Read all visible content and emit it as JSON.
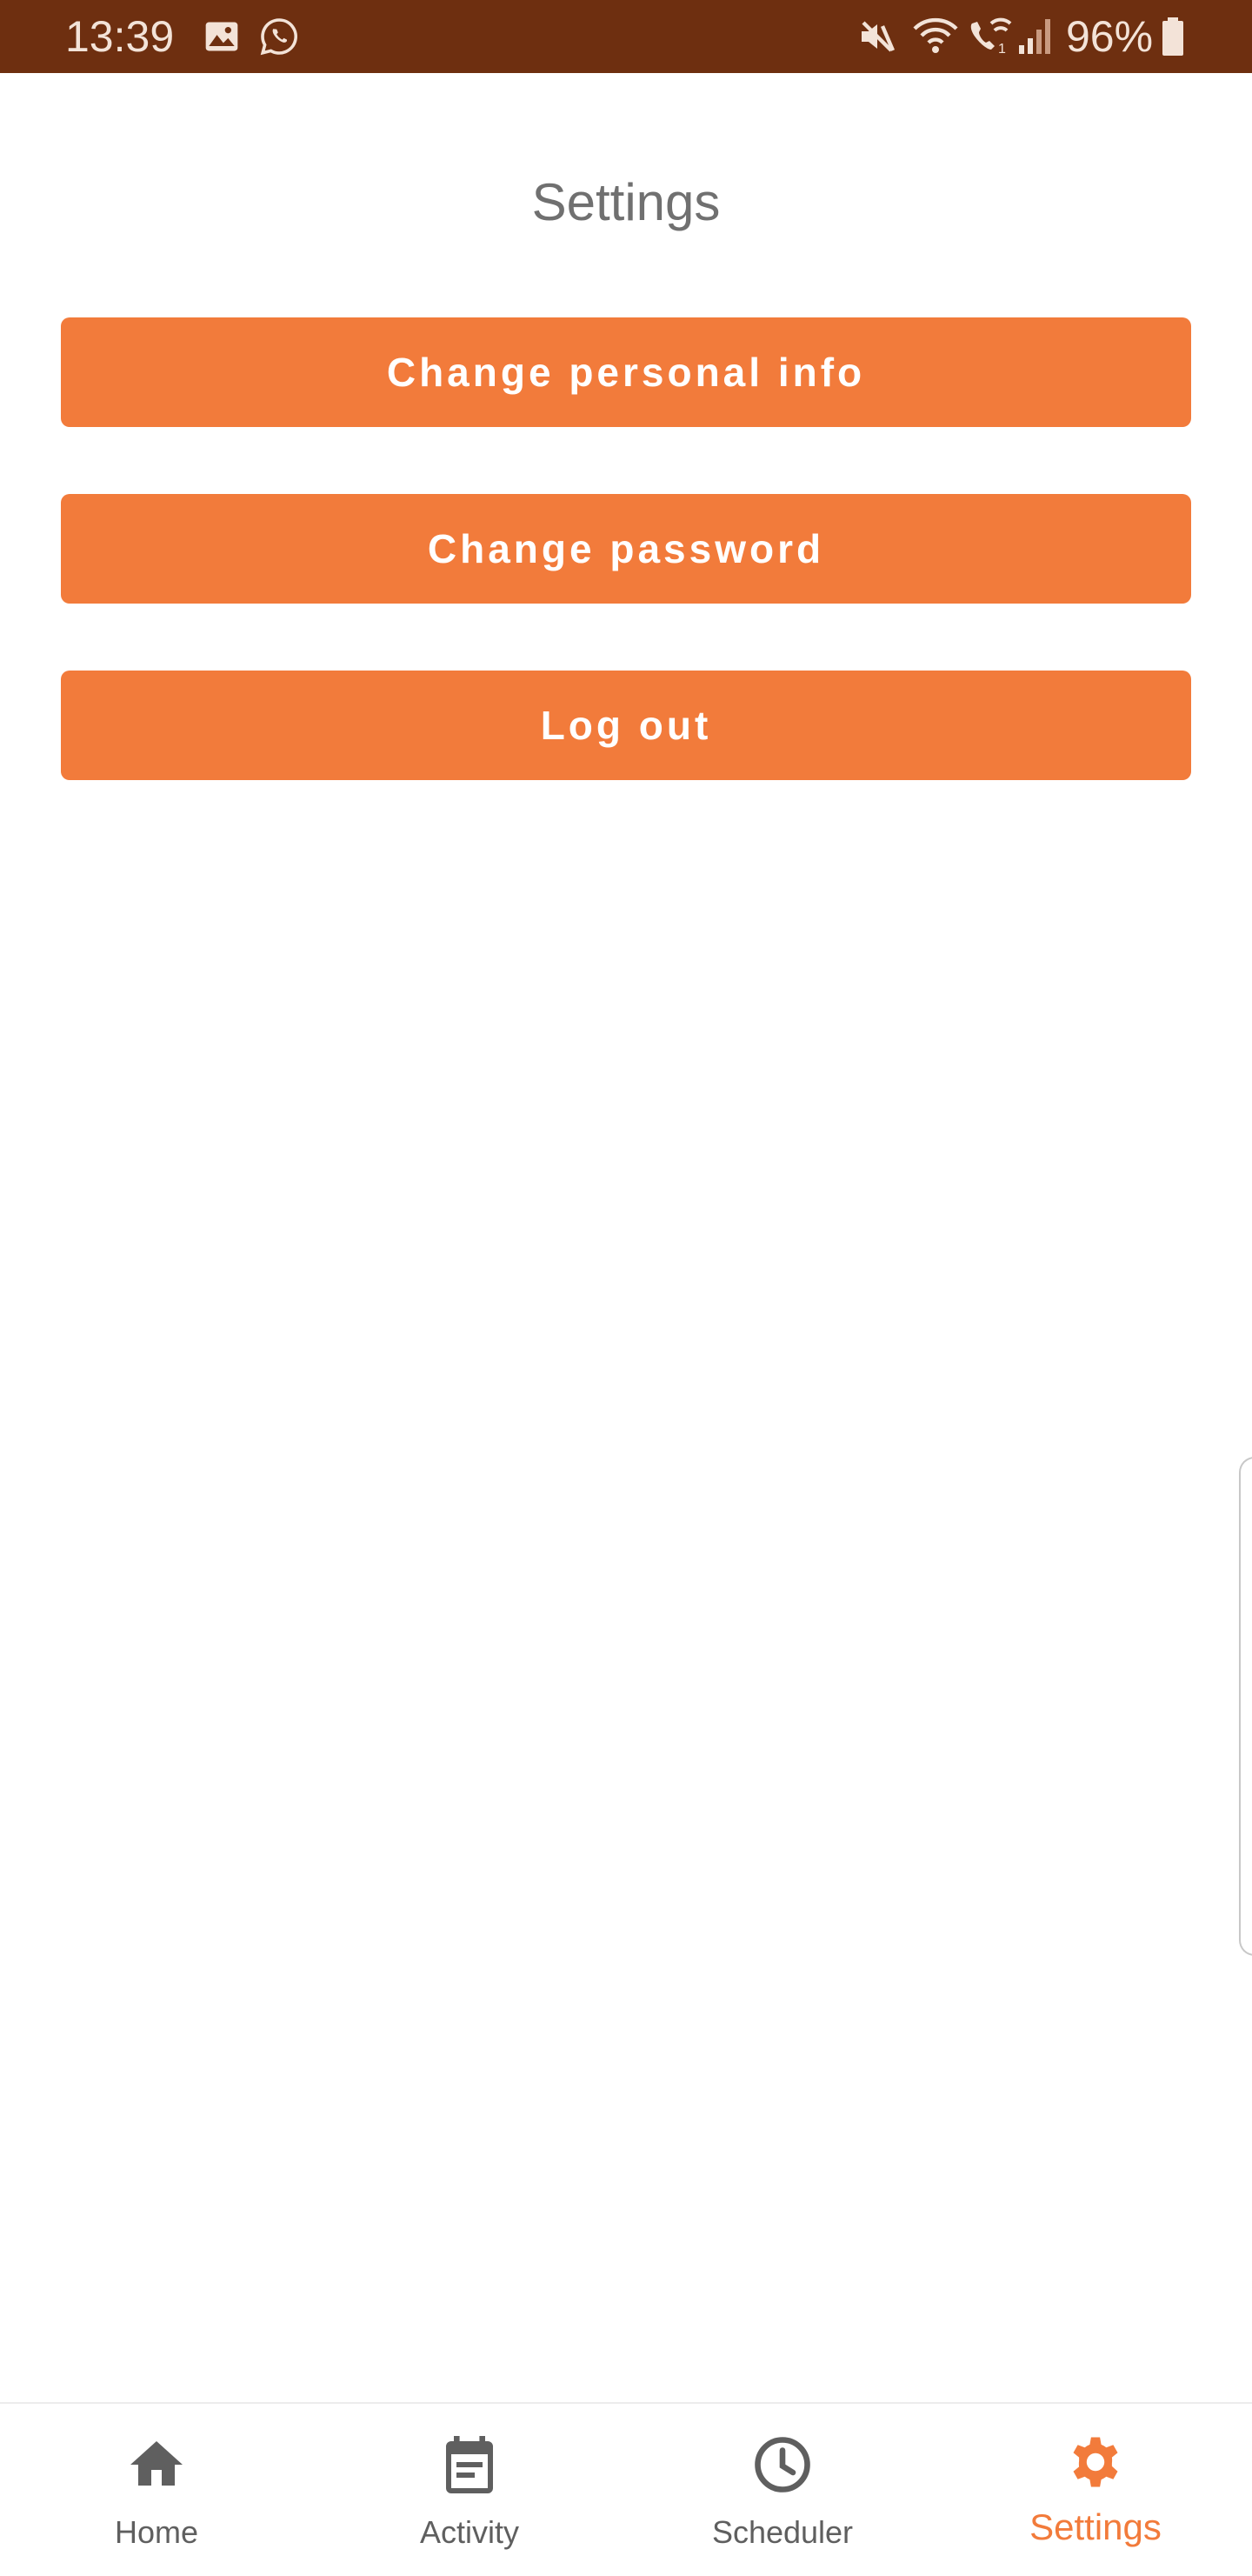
{
  "status_bar": {
    "time": "13:39",
    "battery_percent": "96%",
    "left_icons": [
      "gallery-icon",
      "whatsapp-icon"
    ],
    "right_icons": [
      "mute-icon",
      "wifi-icon",
      "wifi-call-icon",
      "signal-icon",
      "battery-icon"
    ],
    "background_color": "#6e2f10"
  },
  "page": {
    "title": "Settings"
  },
  "buttons": {
    "change_personal_info": "Change personal info",
    "change_password": "Change password",
    "log_out": "Log out",
    "color": "#f27b3b"
  },
  "bottom_nav": {
    "items": [
      {
        "label": "Home",
        "icon": "home-icon",
        "active": false
      },
      {
        "label": "Activity",
        "icon": "calendar-icon",
        "active": false
      },
      {
        "label": "Scheduler",
        "icon": "clock-icon",
        "active": false
      },
      {
        "label": "Settings",
        "icon": "gear-icon",
        "active": true
      }
    ],
    "active_color": "#f27b3b",
    "inactive_color": "#5f5f5f"
  }
}
